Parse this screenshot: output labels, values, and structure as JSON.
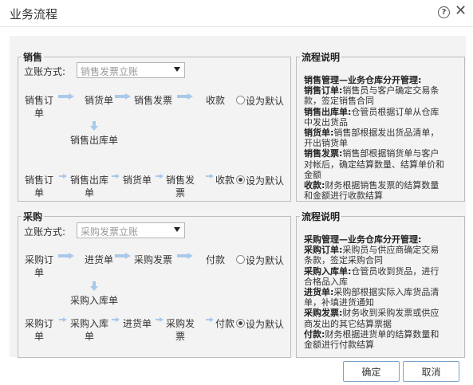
{
  "dialog": {
    "title": "业务流程",
    "help_icon": "question-circle-icon",
    "close_icon": "close-x-icon"
  },
  "sales": {
    "legend": "销售",
    "account_method_label": "立账方式:",
    "account_method_value": "销售发票立账",
    "row1": [
      "销售订\n单",
      "销货单",
      "销售发票",
      "收款"
    ],
    "row1_default": "设为默认",
    "row1_checked": false,
    "branch_node": "销售出库单",
    "row2": [
      "销售订\n单",
      "销售出库\n单",
      "销货单",
      "销售发\n票",
      "收款"
    ],
    "row2_default": "设为默认",
    "row2_checked": true
  },
  "purchase": {
    "legend": "采购",
    "account_method_label": "立账方式:",
    "account_method_value": "采购发票立账",
    "row1": [
      "采购订\n单",
      "进货单",
      "采购发票",
      "付款"
    ],
    "row1_default": "设为默认",
    "row1_checked": false,
    "branch_node": "采购入库单",
    "row2": [
      "采购订\n单",
      "采购入库\n单",
      "进货单",
      "采购发\n票",
      "付款"
    ],
    "row2_default": "设为默认",
    "row2_checked": true
  },
  "sales_desc": {
    "legend": "流程说明",
    "heading": "销售管理—业务仓库分开管理:",
    "items": [
      {
        "term": "销售订单:",
        "text": "销售员与客户确定交易条款，签定销售合同"
      },
      {
        "term": "销售出库单:",
        "text": "仓管员根据订单从仓库中发出货品"
      },
      {
        "term": "销货单:",
        "text": "销售部根据发出货品清单，开出销货单"
      },
      {
        "term": "销售发票:",
        "text": "销售部根据销货单与客户对帐后，确定结算数量、结算单价和金额"
      },
      {
        "term": "收款:",
        "text": "财务根据销售发票的结算数量和金额进行收款结算"
      }
    ]
  },
  "purchase_desc": {
    "legend": "流程说明",
    "heading": "采购管理—业务仓库分开管理:",
    "items": [
      {
        "term": "采购订单:",
        "text": "采购员与供应商确定交易条款，签定采购合同"
      },
      {
        "term": "采购入库单:",
        "text": "仓管员收到货品，进行合格品入库"
      },
      {
        "term": "进货单:",
        "text": "采购部根据实际入库货品清单，补填进货通知"
      },
      {
        "term": "采购发票:",
        "text": "财务收到采购发票或供应商发出的其它结算票据"
      },
      {
        "term": "付款:",
        "text": "财务根据进货单的结算数量和金额进行付款结算"
      }
    ]
  },
  "buttons": {
    "ok": "确定",
    "cancel": "取消"
  }
}
